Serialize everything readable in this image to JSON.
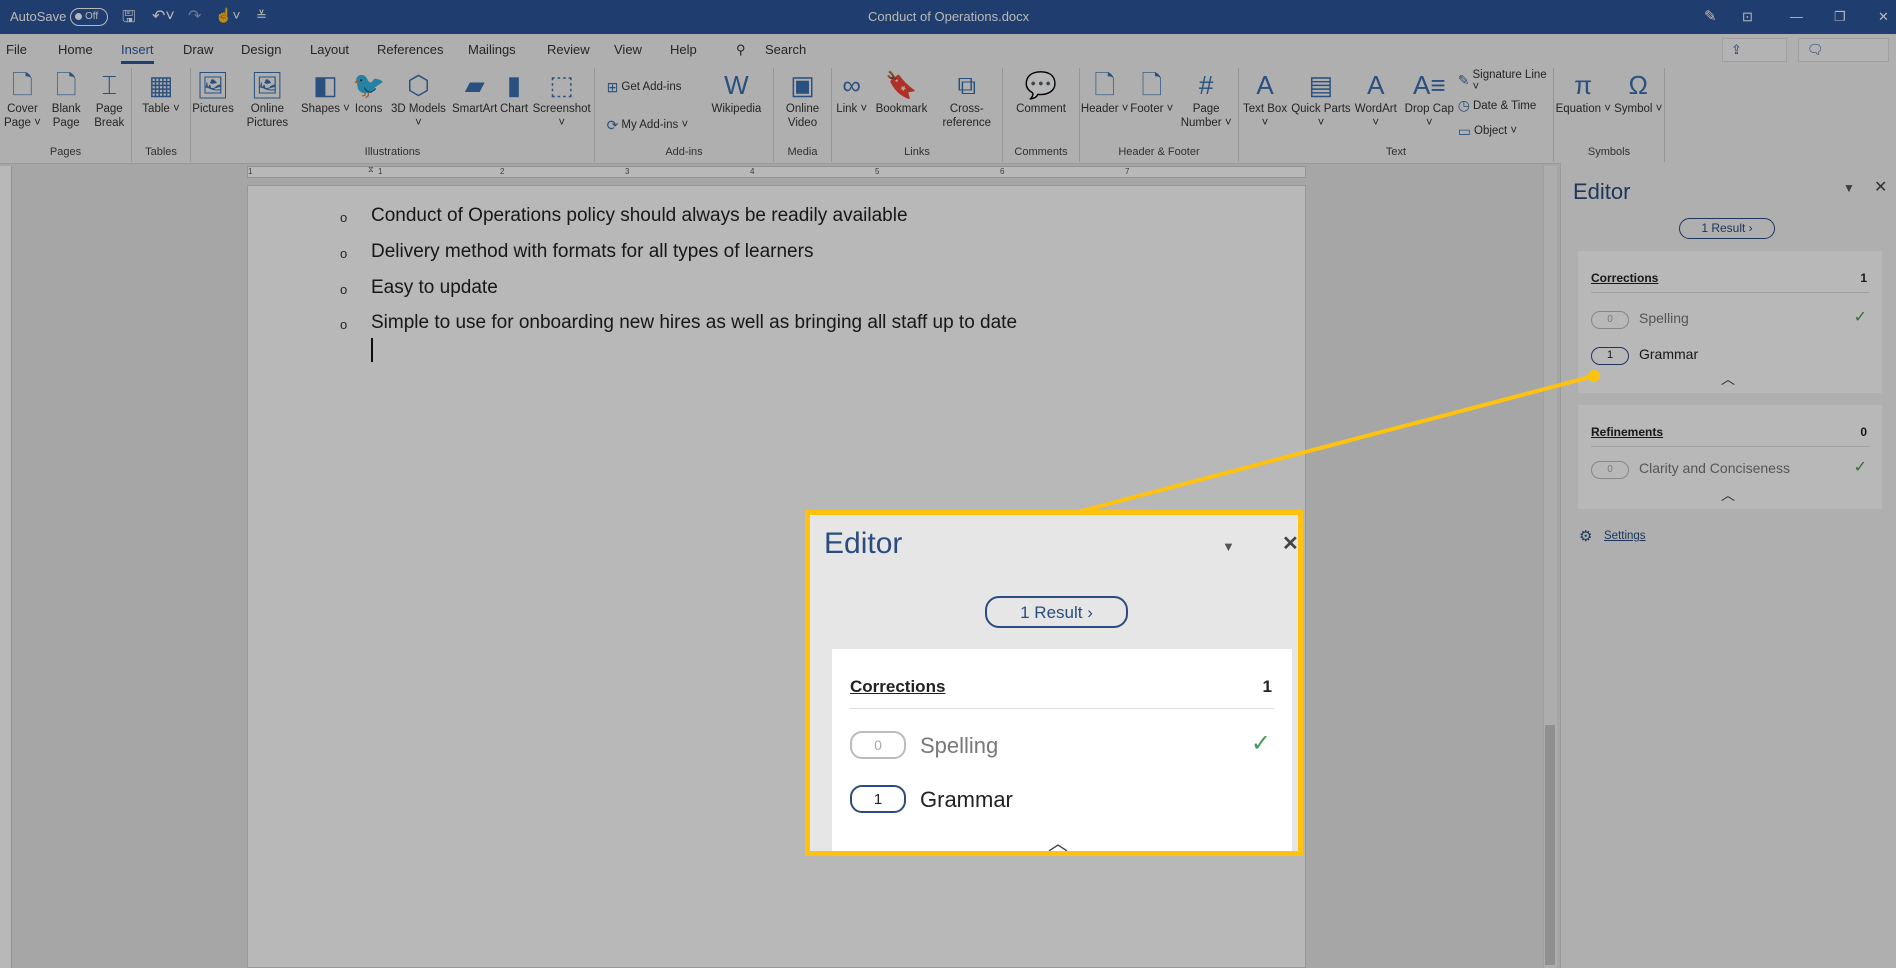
{
  "titlebar": {
    "autosave_label": "AutoSave",
    "autosave_state": "Off",
    "doc_title": "Conduct of Operations.docx",
    "icons": [
      "save-icon",
      "undo-icon",
      "redo-icon",
      "touch-mode-icon",
      "customize-icon",
      "pen-icon",
      "ribbon-display-icon",
      "minimize-icon",
      "restore-icon",
      "close-icon"
    ]
  },
  "tabs": [
    {
      "label": "File"
    },
    {
      "label": "Home"
    },
    {
      "label": "Insert",
      "active": true
    },
    {
      "label": "Draw"
    },
    {
      "label": "Design"
    },
    {
      "label": "Layout"
    },
    {
      "label": "References"
    },
    {
      "label": "Mailings"
    },
    {
      "label": "Review"
    },
    {
      "label": "View"
    },
    {
      "label": "Help"
    }
  ],
  "search": {
    "label": "Search"
  },
  "share_label": "Share",
  "comments_label": "Comments",
  "ribbon": [
    {
      "name": "Pages",
      "items": [
        {
          "label": "Cover Page ˅",
          "icon": "🗋"
        },
        {
          "label": "Blank Page",
          "icon": "🗋"
        },
        {
          "label": "Page Break",
          "icon": "⌶"
        }
      ]
    },
    {
      "name": "Tables",
      "items": [
        {
          "label": "Table ˅",
          "icon": "▦"
        }
      ]
    },
    {
      "name": "Illustrations",
      "items": [
        {
          "label": "Pictures",
          "icon": "🖼"
        },
        {
          "label": "Online Pictures",
          "icon": "🖼"
        },
        {
          "label": "Shapes ˅",
          "icon": "◧"
        },
        {
          "label": "Icons",
          "icon": "🐦"
        },
        {
          "label": "3D Models ˅",
          "icon": "⬡"
        },
        {
          "label": "SmartArt",
          "icon": "▰"
        },
        {
          "label": "Chart",
          "icon": "▮"
        },
        {
          "label": "Screenshot ˅",
          "icon": "⬚"
        }
      ]
    },
    {
      "name": "Add-ins",
      "small": [
        {
          "label": "Get Add-ins",
          "icon": "⊞"
        },
        {
          "label": "My Add-ins ˅",
          "icon": "⟳"
        }
      ],
      "items": [
        {
          "label": "Wikipedia",
          "icon": "W"
        }
      ]
    },
    {
      "name": "Media",
      "items": [
        {
          "label": "Online Video",
          "icon": "▣"
        }
      ]
    },
    {
      "name": "Links",
      "items": [
        {
          "label": "Link ˅",
          "icon": "∞"
        },
        {
          "label": "Bookmark",
          "icon": "🔖"
        },
        {
          "label": "Cross-reference",
          "icon": "⧉"
        }
      ]
    },
    {
      "name": "Comments",
      "items": [
        {
          "label": "Comment",
          "icon": "💬"
        }
      ]
    },
    {
      "name": "Header & Footer",
      "items": [
        {
          "label": "Header ˅",
          "icon": "🗋"
        },
        {
          "label": "Footer ˅",
          "icon": "🗋"
        },
        {
          "label": "Page Number ˅",
          "icon": "#"
        }
      ]
    },
    {
      "name": "Text",
      "items": [
        {
          "label": "Text Box ˅",
          "icon": "A"
        },
        {
          "label": "Quick Parts ˅",
          "icon": "▤"
        },
        {
          "label": "WordArt ˅",
          "icon": "A"
        },
        {
          "label": "Drop Cap ˅",
          "icon": "A≡"
        }
      ],
      "small": [
        {
          "label": "Signature Line ˅",
          "icon": "✎"
        },
        {
          "label": "Date & Time",
          "icon": "◷"
        },
        {
          "label": "Object ˅",
          "icon": "▭"
        }
      ]
    },
    {
      "name": "Symbols",
      "items": [
        {
          "label": "Equation ˅",
          "icon": "π"
        },
        {
          "label": "Symbol ˅",
          "icon": "Ω"
        }
      ]
    }
  ],
  "ruler_numbers": [
    "1",
    "1",
    "2",
    "3",
    "4",
    "5",
    "6",
    "7"
  ],
  "document": {
    "bullet": "o",
    "lines": [
      "Conduct of Operations policy should always be readily available",
      "Delivery method with formats for all types of learners",
      "Easy to update",
      "Simple to use for onboarding new hires as well as bringing all staff up to date"
    ]
  },
  "editor": {
    "title": "Editor",
    "result_button": "1 Result ›",
    "corrections": {
      "title": "Corrections",
      "count": "1",
      "items": [
        {
          "count": "0",
          "label": "Spelling",
          "done": true
        },
        {
          "count": "1",
          "label": "Grammar",
          "done": false
        }
      ]
    },
    "refinements": {
      "title": "Refinements",
      "count": "0",
      "items": [
        {
          "count": "0",
          "label": "Clarity and Conciseness",
          "done": true
        }
      ]
    },
    "settings_label": "Settings"
  },
  "colors": {
    "title_bar": "#2b579a",
    "highlight": "#ffc20e",
    "check": "#4a9a56"
  }
}
